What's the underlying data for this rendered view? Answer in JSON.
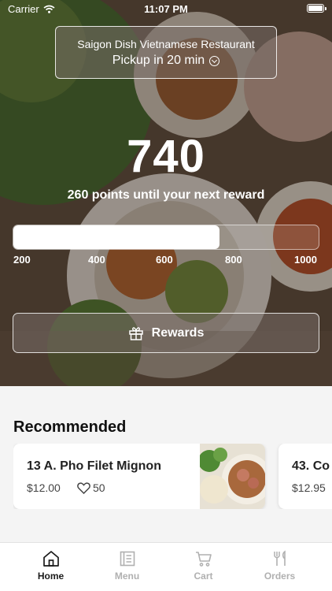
{
  "status_bar": {
    "carrier": "Carrier",
    "time": "11:07 PM"
  },
  "restaurant": {
    "name": "Saigon Dish Vietnamese Restaurant",
    "pickup": "Pickup in 20 min"
  },
  "loyalty": {
    "points": "740",
    "subtitle": "260 points until your next reward",
    "progress_value": 740,
    "progress_min": 200,
    "progress_max": 1000,
    "ticks": [
      "200",
      "400",
      "600",
      "800",
      "1000"
    ]
  },
  "rewards_button": {
    "label": "Rewards"
  },
  "recommended": {
    "title": "Recommended",
    "items": [
      {
        "title": "13 A. Pho Filet Mignon",
        "price": "$12.00",
        "likes": "50"
      },
      {
        "title": "43. Co",
        "price": "$12.95"
      }
    ]
  },
  "tabs": [
    {
      "label": "Home",
      "icon": "home-icon",
      "active": true
    },
    {
      "label": "Menu",
      "icon": "menu-icon",
      "active": false
    },
    {
      "label": "Cart",
      "icon": "cart-icon",
      "active": false
    },
    {
      "label": "Orders",
      "icon": "orders-icon",
      "active": false
    }
  ],
  "colors": {
    "active_tab": "#1a1a1a",
    "inactive_tab": "#b0b0b0",
    "progress_fill": "#ffffff"
  }
}
